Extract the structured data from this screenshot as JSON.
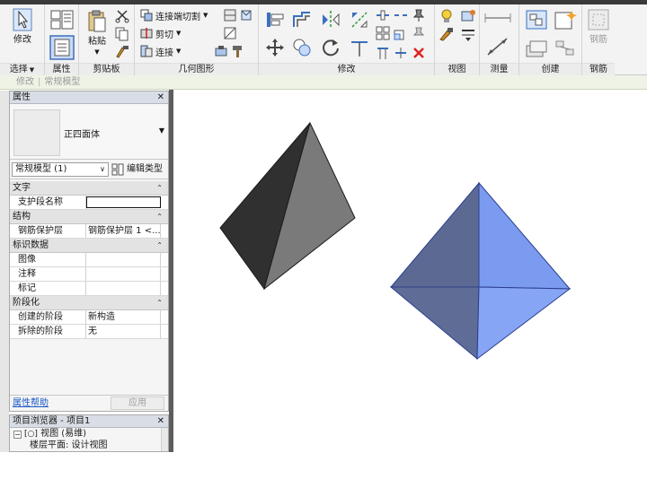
{
  "ribbon": {
    "panels": [
      {
        "id": "select",
        "title": "选择",
        "has_dropdown": true
      },
      {
        "id": "properties",
        "title": "属性"
      },
      {
        "id": "clipboard",
        "title": "剪贴板"
      },
      {
        "id": "geometry",
        "title": "几何图形"
      },
      {
        "id": "modify",
        "title": "修改"
      },
      {
        "id": "view",
        "title": "视图"
      },
      {
        "id": "measure",
        "title": "测量"
      },
      {
        "id": "create",
        "title": "创建"
      },
      {
        "id": "rebar",
        "title": "钢筋"
      }
    ],
    "modify_button": "修改",
    "paste_button": "粘贴",
    "join_cut": "连接端切割",
    "cut": "剪切",
    "join": "连接",
    "rebar_button": "钢筋"
  },
  "options_bar": {
    "mode": "修改",
    "context": "常规模型"
  },
  "properties": {
    "title": "属性",
    "type_name": "正四面体",
    "instance_filter": "常规模型 (1)",
    "edit_type": "编辑类型",
    "groups": [
      {
        "name": "文字",
        "rows": [
          {
            "key": "支护段名称",
            "value": "",
            "editing": true
          }
        ]
      },
      {
        "name": "结构",
        "rows": [
          {
            "key": "钢筋保护层",
            "value": "钢筋保护层 1 <..."
          }
        ]
      },
      {
        "name": "标识数据",
        "rows": [
          {
            "key": "图像",
            "value": ""
          },
          {
            "key": "注释",
            "value": ""
          },
          {
            "key": "标记",
            "value": ""
          }
        ]
      },
      {
        "name": "阶段化",
        "rows": [
          {
            "key": "创建的阶段",
            "value": "新构造"
          },
          {
            "key": "拆除的阶段",
            "value": "无"
          }
        ]
      }
    ],
    "help_link": "属性帮助",
    "apply": "应用"
  },
  "project_browser": {
    "title": "项目浏览器 - 项目1",
    "items": [
      "视图 (易维)",
      "楼层平面: 设计视图"
    ]
  },
  "colors": {
    "selected_fill": "#7b9bf0",
    "selected_edge": "#2b3f8f",
    "dark_face": "#303030",
    "grey_face": "#7a7a7a"
  }
}
